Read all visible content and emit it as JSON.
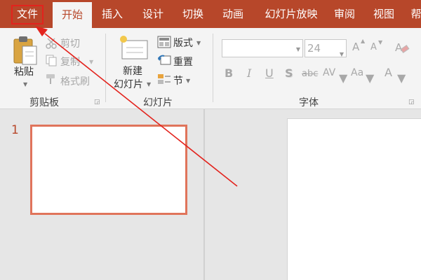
{
  "tabs": [
    "文件",
    "开始",
    "插入",
    "设计",
    "切换",
    "动画",
    "幻灯片放映",
    "审阅",
    "视图",
    "帮"
  ],
  "active_tab": "开始",
  "clipboard": {
    "paste_label": "粘贴",
    "cut_label": "剪切",
    "copy_label": "复制",
    "format_painter_label": "格式刷",
    "group_label": "剪贴板"
  },
  "slides_group": {
    "new_slide_line1": "新建",
    "new_slide_line2": "幻灯片",
    "layout_label": "版式",
    "reset_label": "重置",
    "section_label": "节",
    "group_label": "幻灯片"
  },
  "font_group": {
    "font_name": "",
    "font_size": "24",
    "group_label": "字体",
    "bold": "B",
    "italic": "I",
    "underline": "U",
    "shadow": "S",
    "strikethrough": "abc",
    "char_spacing": "AV",
    "change_case": "Aa",
    "font_color": "A",
    "grow": "A",
    "shrink": "A"
  },
  "slides": [
    {
      "number": "1"
    }
  ],
  "colors": {
    "accent": "#b7472a",
    "highlight": "#e3231d",
    "thumb_border": "#e0745b"
  }
}
